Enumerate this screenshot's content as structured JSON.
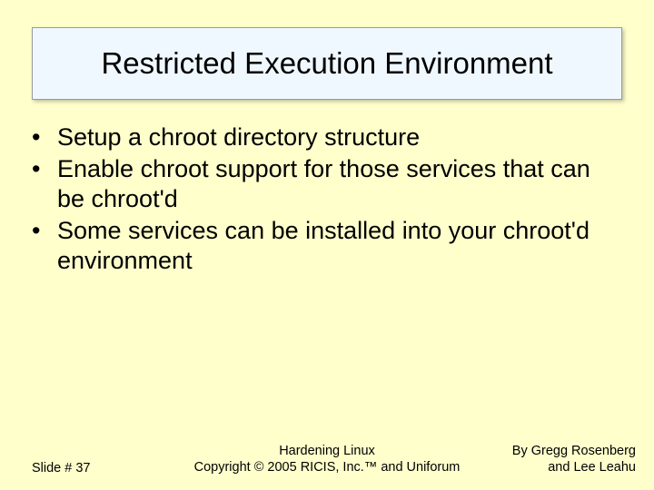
{
  "title": "Restricted Execution Environment",
  "bullets": [
    "Setup a chroot directory structure",
    "Enable chroot support for those services that can be chroot'd",
    "Some services can be installed into your chroot'd environment"
  ],
  "footer": {
    "slide_number": "Slide # 37",
    "center_line1": "Hardening Linux",
    "center_line2": "Copyright © 2005 RICIS, Inc.™ and Uniforum",
    "right_line1": "By Gregg Rosenberg",
    "right_line2": "and Lee Leahu"
  }
}
